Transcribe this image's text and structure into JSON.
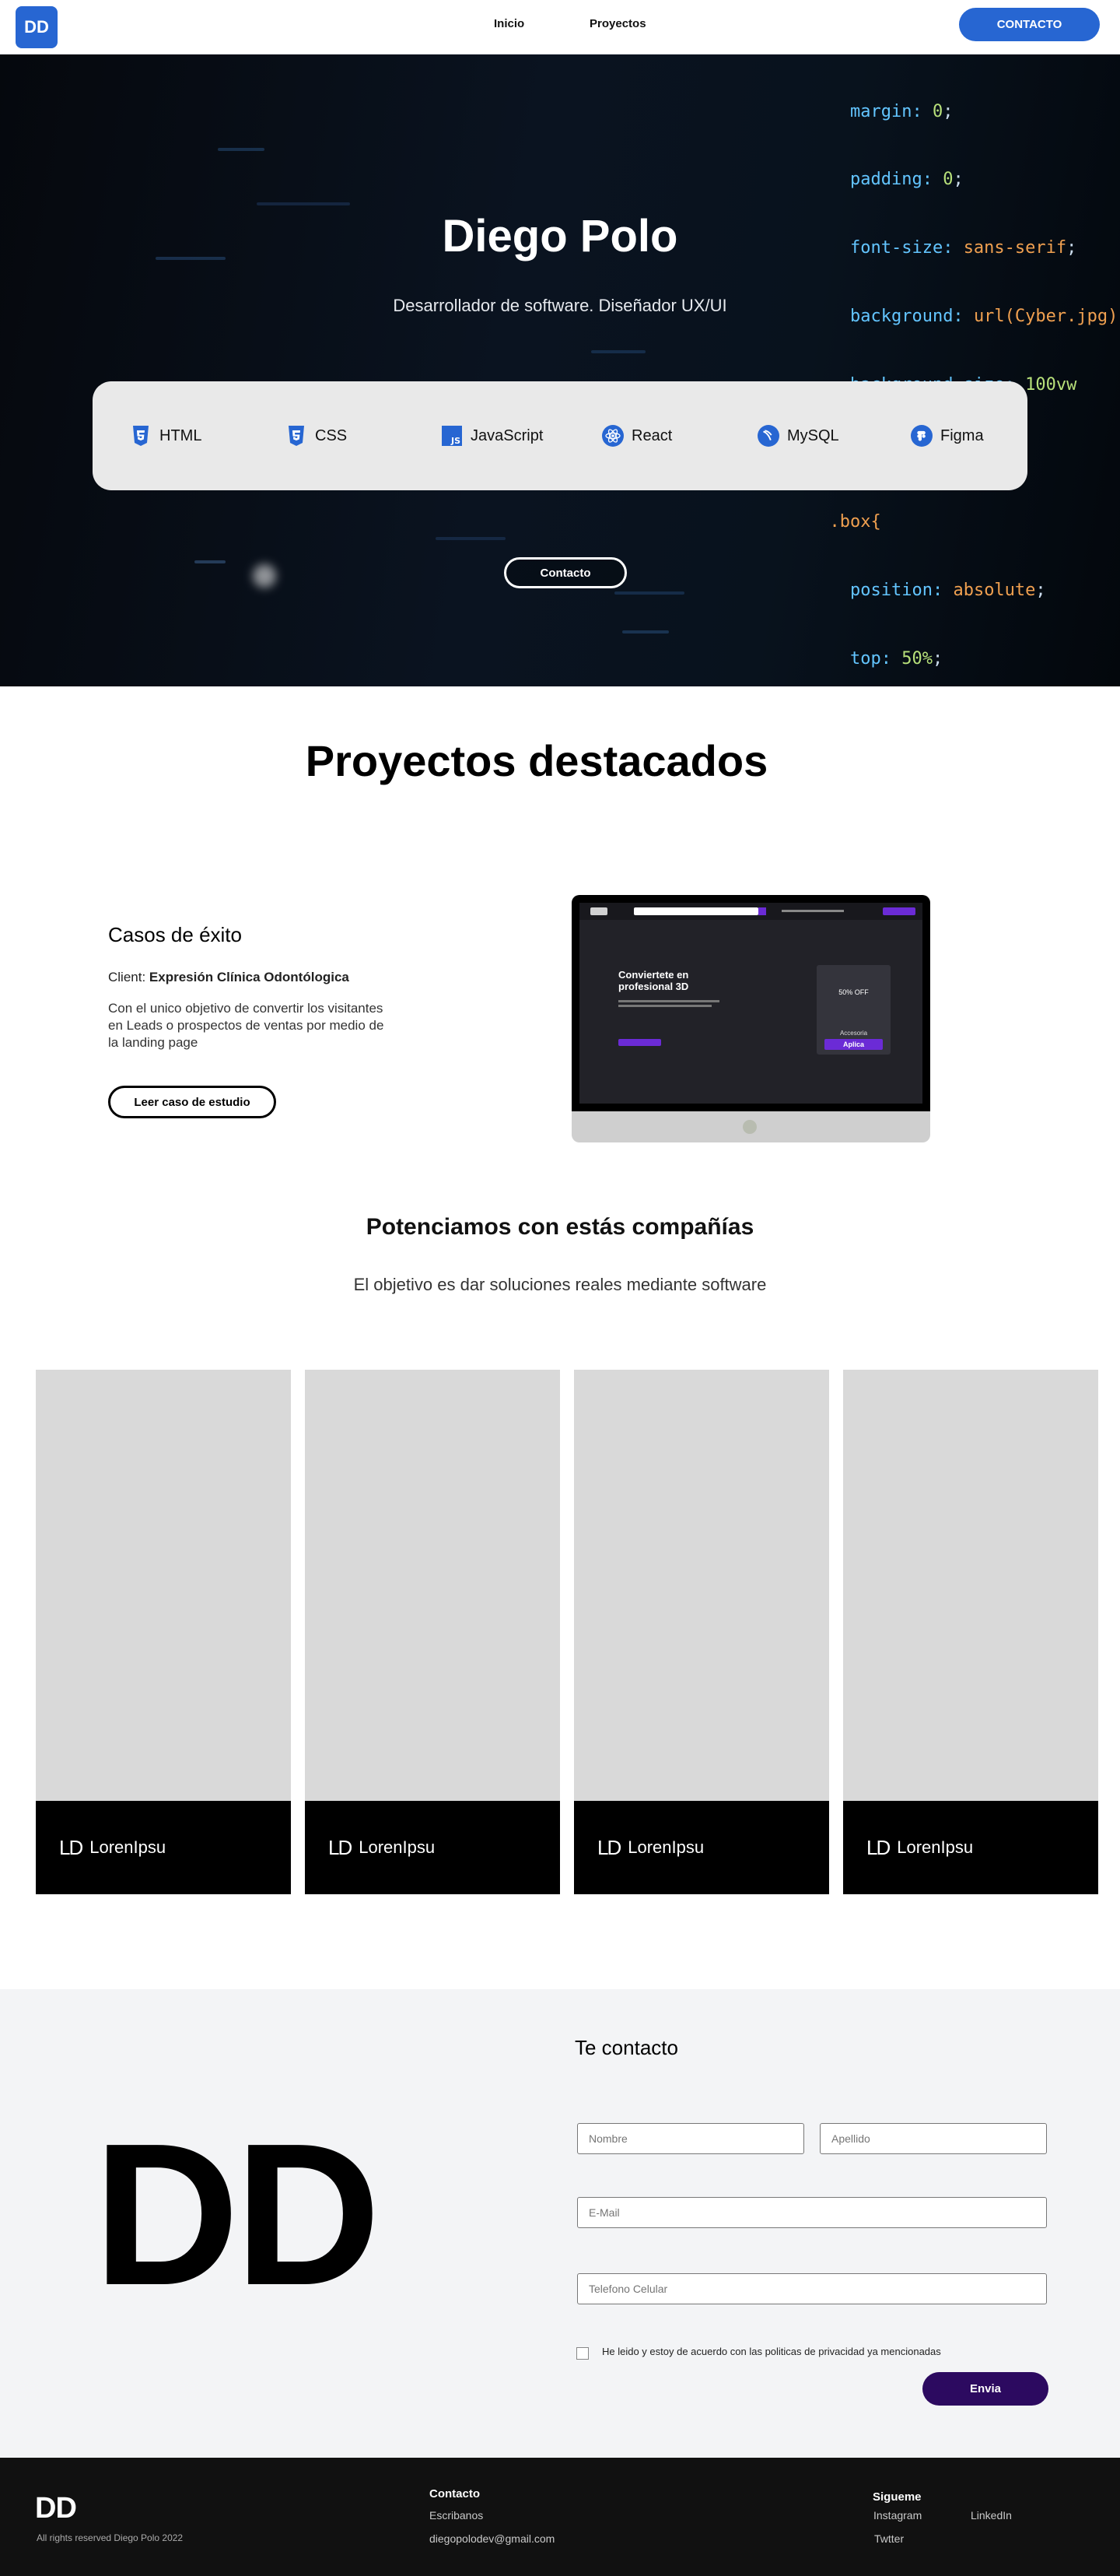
{
  "nav": {
    "logo": "DD",
    "links": [
      "Inicio",
      "Proyectos"
    ],
    "cta": "CONTACTO"
  },
  "hero": {
    "title": "Diego Polo",
    "subtitle": "Desarrollador de software. Diseñador UX/UI",
    "skills": [
      {
        "label": "HTML",
        "icon": "html5-icon"
      },
      {
        "label": "CSS",
        "icon": "css3-icon"
      },
      {
        "label": "JavaScript",
        "icon": "javascript-icon"
      },
      {
        "label": "React",
        "icon": "react-icon"
      },
      {
        "label": "MySQL",
        "icon": "mysql-icon"
      },
      {
        "label": "Figma",
        "icon": "figma-icon"
      }
    ],
    "button": "Contacto"
  },
  "projects": {
    "title": "Proyectos destacados",
    "case": {
      "title": "Casos  de éxito",
      "client_prefix": "Client:",
      "client_name": "Expresión Clínica Odontólogica",
      "description": "Con el unico objetivo de convertir los visitantes en Leads o prospectos de ventas por medio de la landing page",
      "button": "Leer caso de estudio"
    },
    "mockup": {
      "headline": "Conviertete en profesional 3D",
      "badge_title": "50% OFF",
      "badge_cta": "Aplica",
      "badge_sub": "Accesoria"
    }
  },
  "partners": {
    "title": "Potenciamos con estás compañías",
    "subtitle": "El objetivo es dar soluciones reales mediante software",
    "cards": [
      {
        "mark": "LD",
        "name": "LorenIpsu"
      },
      {
        "mark": "LD",
        "name": "LorenIpsu"
      },
      {
        "mark": "LD",
        "name": "LorenIpsu"
      },
      {
        "mark": "LD",
        "name": "LorenIpsu"
      }
    ]
  },
  "contact": {
    "big_logo": "DD",
    "title": "Te contacto",
    "placeholders": {
      "first_name": "Nombre",
      "last_name": "Apellido",
      "email": "E-Mail",
      "phone": "Telefono Celular"
    },
    "consent": "He leido y estoy de acuerdo con las politicas de privacidad ya mencionadas",
    "submit": "Envia"
  },
  "footer": {
    "logo": "DD",
    "copyright": "All rights reserved Diego Polo 2022",
    "contact_heading": "Contacto",
    "contact_links": [
      "Escribanos",
      "diegopolodev@gmail.com"
    ],
    "social_heading": "Siguеme",
    "social_links": [
      "Instagram",
      "LinkedIn",
      "Twtter"
    ]
  },
  "colors": {
    "primary": "#2766d2",
    "submit": "#2c0a60",
    "footer_bg": "#111111",
    "contact_bg": "#f3f4f6"
  }
}
